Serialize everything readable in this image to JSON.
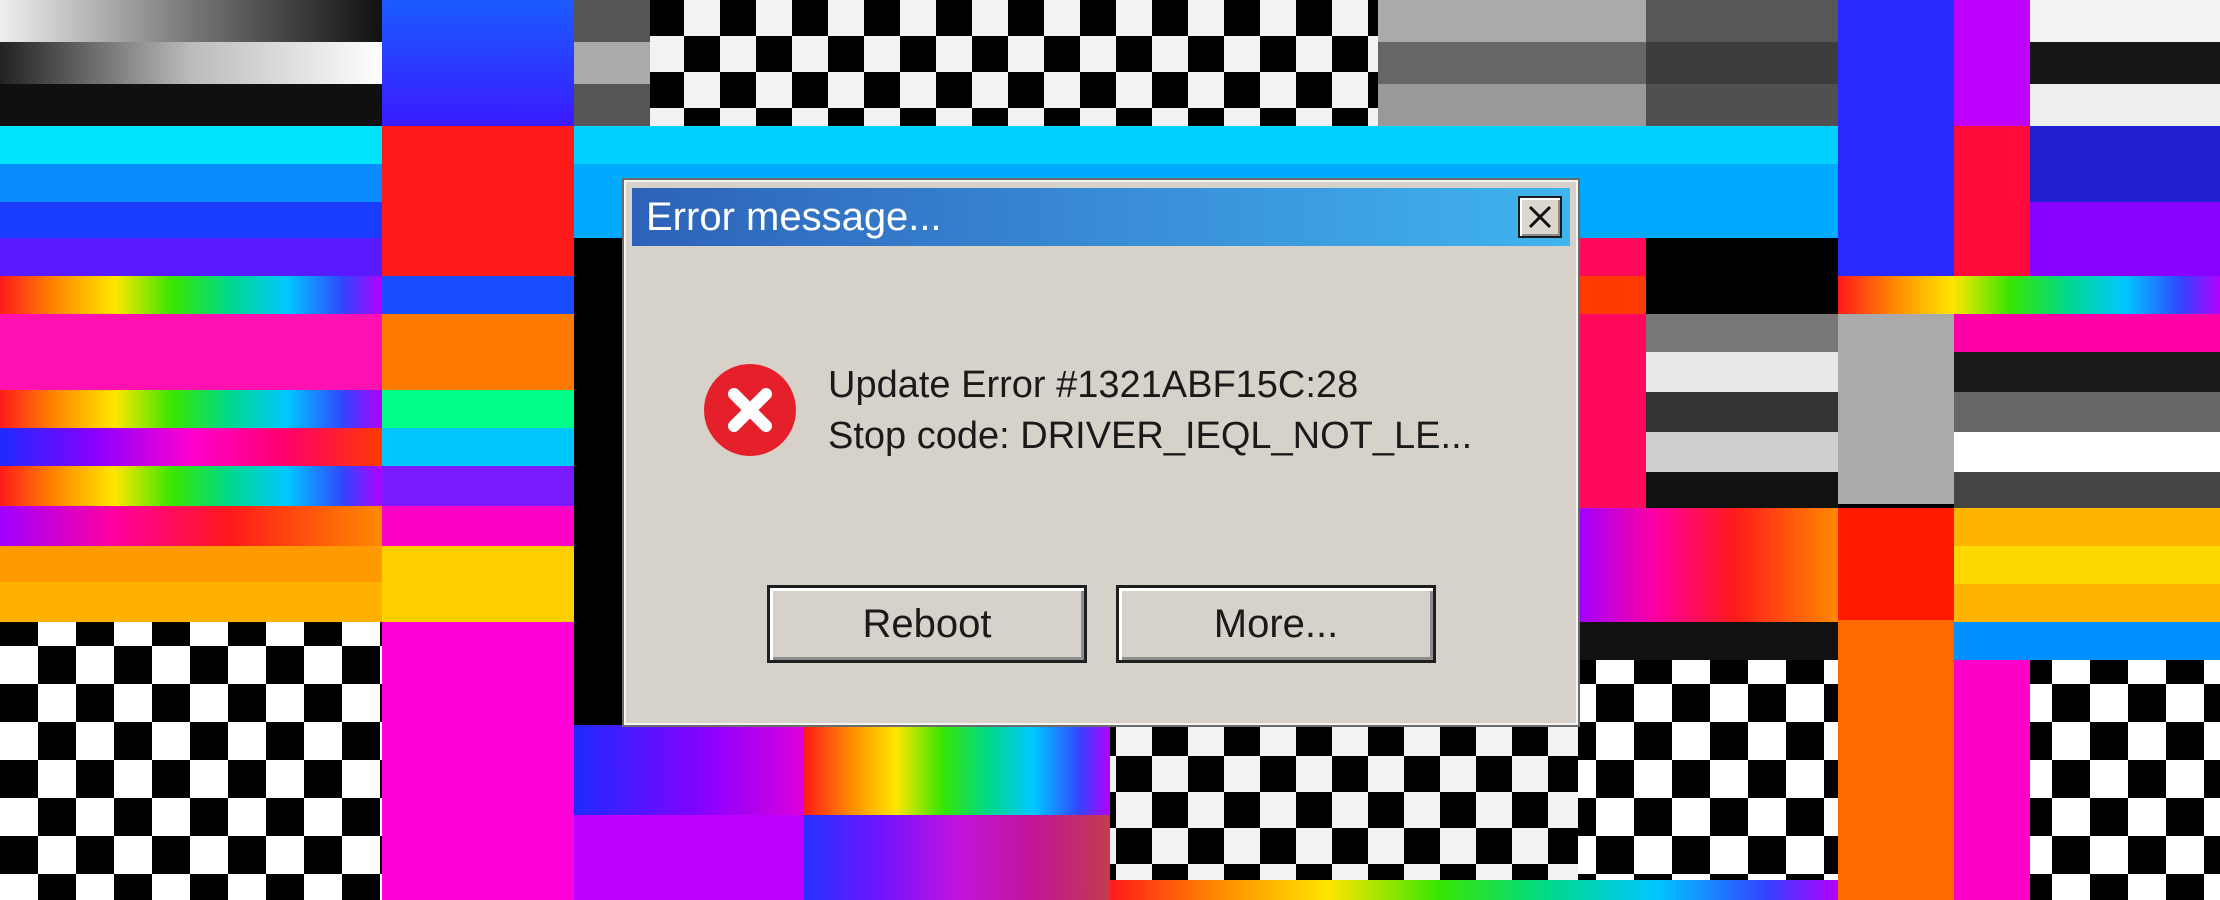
{
  "dialog": {
    "title": "Error message...",
    "message_line1": "Update Error #1321ABF15C:28",
    "message_line2": "Stop code: DRIVER_IEQL_NOT_LE...",
    "buttons": {
      "reboot": "Reboot",
      "more": "More..."
    },
    "icons": {
      "close": "close-icon",
      "error": "error-x-icon"
    }
  },
  "colors": {
    "dialog_bg": "#d7d2c9",
    "title_start": "#2d62b8",
    "title_end": "#3fb4ee",
    "error_red": "#e5202b"
  }
}
